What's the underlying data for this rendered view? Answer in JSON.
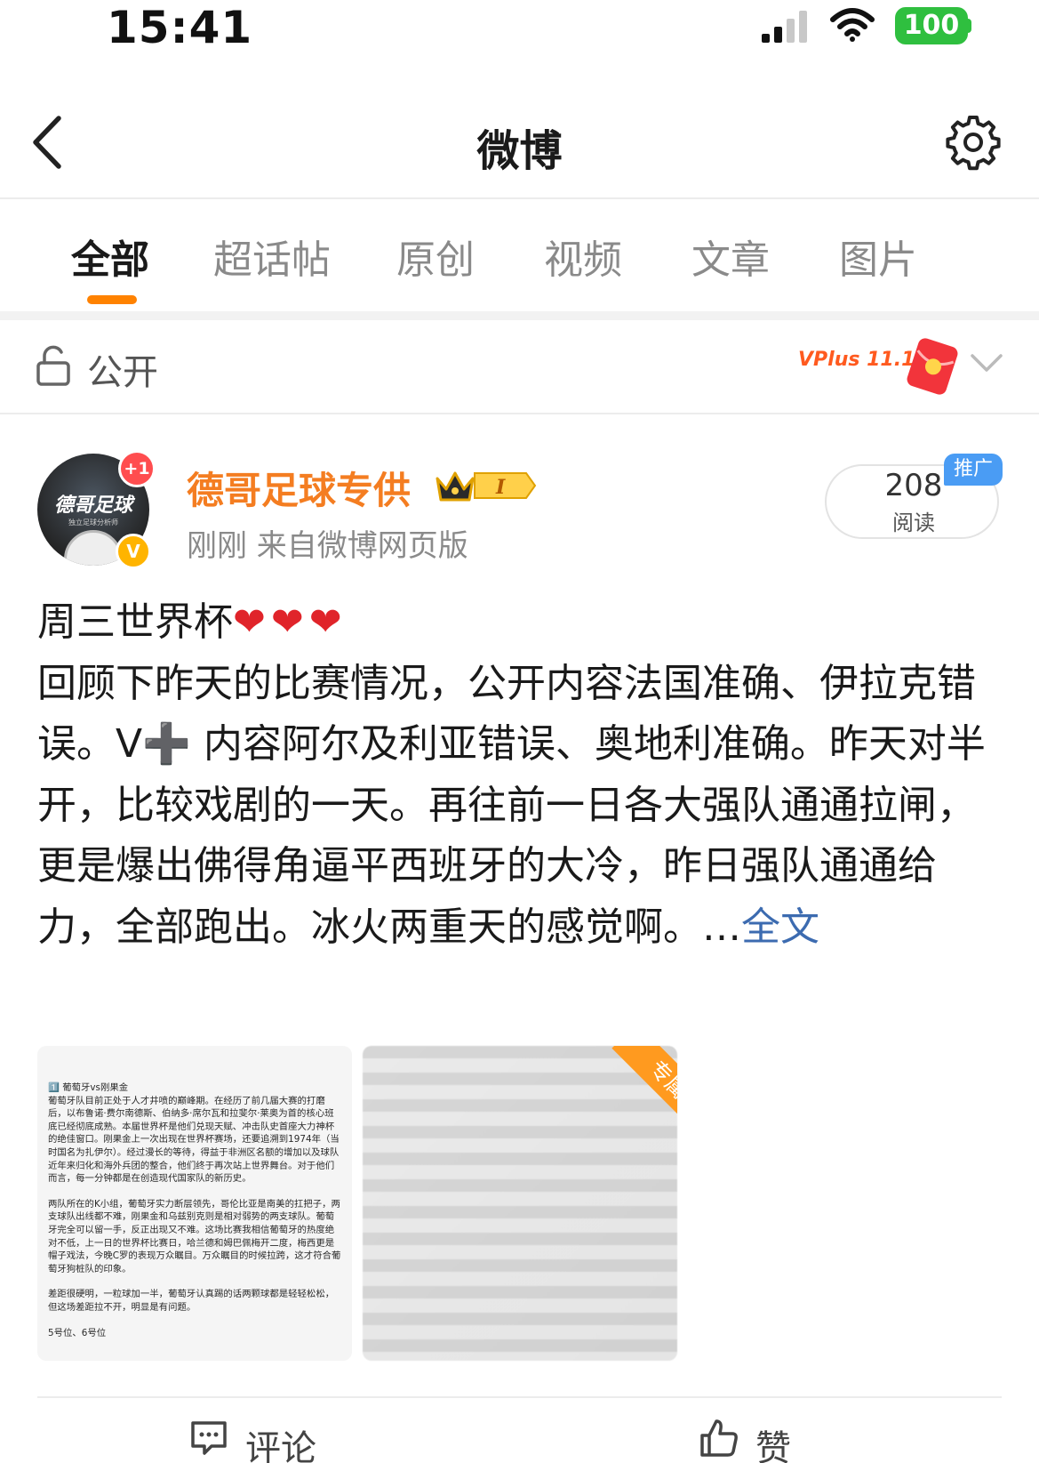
{
  "status_bar": {
    "time": "15:41",
    "battery": "100"
  },
  "header": {
    "title": "微博"
  },
  "tabs": [
    {
      "label": "全部",
      "active": true
    },
    {
      "label": "超话帖",
      "active": false
    },
    {
      "label": "原创",
      "active": false
    },
    {
      "label": "视频",
      "active": false
    },
    {
      "label": "文章",
      "active": false
    },
    {
      "label": "图片",
      "active": false
    }
  ],
  "visibility": {
    "label": "公开",
    "promo_badge": "VPlus 11.11"
  },
  "post": {
    "user_name": "德哥足球专供",
    "avatar_text": "德哥足球",
    "avatar_sub": "独立足球分析师",
    "avatar_badge": "+1",
    "verified_badge": "V",
    "level_badge": "I",
    "meta": "刚刚  来自微博网页版",
    "reads_count": "208",
    "reads_label": "阅读",
    "promo_tag": "推广",
    "headline": "周三世界杯",
    "hearts": "❤❤❤",
    "body": "回顾下昨天的比赛情况，公开内容法国准确、伊拉克错误。V➕ 内容阿尔及利亚错误、奥地利准确。昨天对半开，比较戏剧的一天。再往前一日各大强队通通拉闸，更是爆出佛得角逼平西班牙的大冷，昨日强队通通给力，全部跑出。冰火两重天的感觉啊。…",
    "full_text_link": "全文",
    "image1_paragraphs": [
      "1️⃣ 葡萄牙vs刚果金\n葡萄牙队目前正处于人才井喷的巅峰期。在经历了前几届大赛的打磨后，以布鲁诺·费尔南德斯、伯纳多·席尔瓦和拉斐尔·莱奥为首的核心班底已经彻底成熟。本届世界杯是他们兑现天赋、冲击队史首座大力神杯的绝佳窗口。刚果金上一次出现在世界杯赛场，还要追溯到1974年（当时国名为扎伊尔）。经过漫长的等待，得益于非洲区名额的增加以及球队近年来归化和海外兵团的整合，他们终于再次站上世界舞台。对于他们而言，每一分钟都是在创造现代国家队的新历史。",
      "两队所在的K小组，葡萄牙实力断层领先，哥伦比亚是南美的扛把子，两支球队出线都不难，刚果金和乌兹别克则是相对弱势的两支球队。葡萄牙完全可以留一手，反正出现又不难。这场比赛我相信葡萄牙的热度绝对不低，上一日的世界杯比赛日，哈兰德和姆巴佩梅开二度，梅西更是帽子戏法，今晚C罗的表现万众瞩目。万众瞩目的时候拉跨，这才符合葡萄牙狗桩队的印象。",
      "差距很硬明，一粒球加一半，葡萄牙认真踢的话两颗球都是轻轻松松，但这场差距拉不开，明显是有问题。",
      "5号位、6号位"
    ],
    "exclusive_label": "专属"
  },
  "actions": {
    "comment": "评论",
    "like": "赞"
  },
  "colors": {
    "accent": "#ff8200",
    "username": "#f47d21",
    "link": "#3c6bb0",
    "heart": "#e0242a",
    "battery": "#2fbf3f",
    "promo_tag": "#4a9cf4"
  }
}
